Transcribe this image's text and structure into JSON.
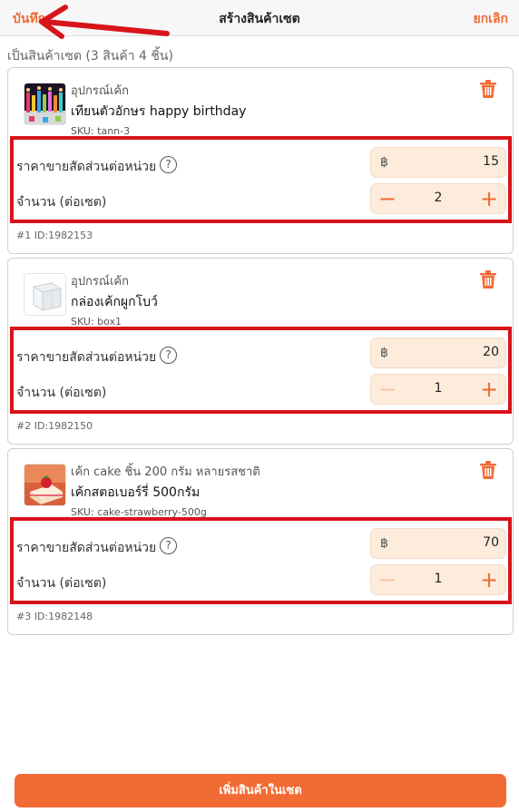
{
  "header": {
    "save_label": "บันทึก",
    "title": "สร้างสินค้าเซต",
    "cancel_label": "ยกเลิก"
  },
  "set_label": "เป็นสินค้าเซต (3 สินค้า 4 ชิ้น)",
  "labels": {
    "price": "ราคาขายสัดส่วนต่อหน่วย",
    "qty": "จำนวน (ต่อเซต)",
    "currency": "฿",
    "help": "?"
  },
  "items": [
    {
      "category": "อุปกรณ์เค้ก",
      "name": "เทียนตัวอักษร happy birthday",
      "sku": "SKU: tann-3",
      "price": "15",
      "qty": "2",
      "item_id": "#1 ID:1982153",
      "thumb_icon": "birthday-candles-image"
    },
    {
      "category": "อุปกรณ์เค้ก",
      "name": "กล่องเค้กผูกโบว์",
      "sku": "SKU: box1",
      "price": "20",
      "qty": "1",
      "item_id": "#2 ID:1982150",
      "thumb_icon": "cake-box-image"
    },
    {
      "category": "เค้ก cake ชิ้น 200 กรัม หลายรสชาติ",
      "name": "เค้กสตอเบอร์รี่ 500กรัม",
      "sku": "SKU: cake-strawberry-500g",
      "price": "70",
      "qty": "1",
      "item_id": "#3 ID:1982148",
      "thumb_icon": "strawberry-cake-image"
    }
  ],
  "icons": {
    "delete": "trash-icon",
    "minus": "minus-icon",
    "plus": "plus-icon",
    "help": "help-circle-icon"
  },
  "add_button_label": "เพิ่มสินค้าในเซต",
  "colors": {
    "accent": "#f26b35",
    "highlight": "#d8141b",
    "input_bg": "#fdebdc"
  }
}
